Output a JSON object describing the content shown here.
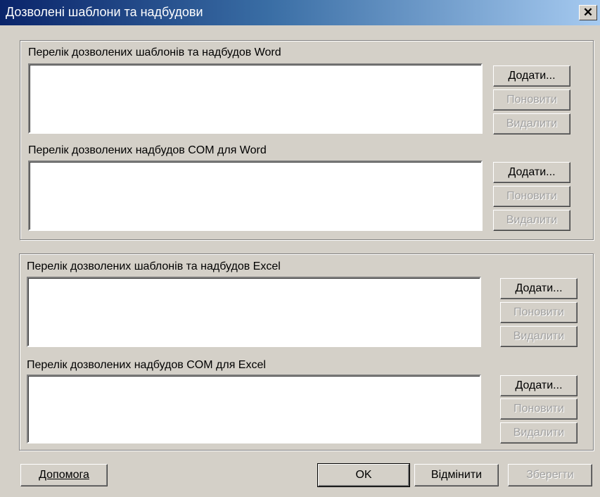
{
  "window": {
    "title": "Дозволені шаблони та надбудови",
    "close_glyph": "✕"
  },
  "word": {
    "templates": {
      "label": "Перелік дозволених шаблонів та надбудов Word",
      "add": "Додати...",
      "update": "Поновити",
      "remove": "Видалити"
    },
    "com": {
      "label": "Перелік дозволених надбудов COM для Word",
      "add": "Додати...",
      "update": "Поновити",
      "remove": "Видалити"
    }
  },
  "excel": {
    "templates": {
      "label": "Перелік дозволених шаблонів та надбудов Excel",
      "add": "Додати...",
      "update": "Поновити",
      "remove": "Видалити"
    },
    "com": {
      "label": "Перелік дозволених надбудов COM для Excel",
      "add": "Додати...",
      "update": "Поновити",
      "remove": "Видалити"
    }
  },
  "footer": {
    "help": "Допомога",
    "ok": "OK",
    "cancel": "Відмінити",
    "save": "Зберегти"
  }
}
